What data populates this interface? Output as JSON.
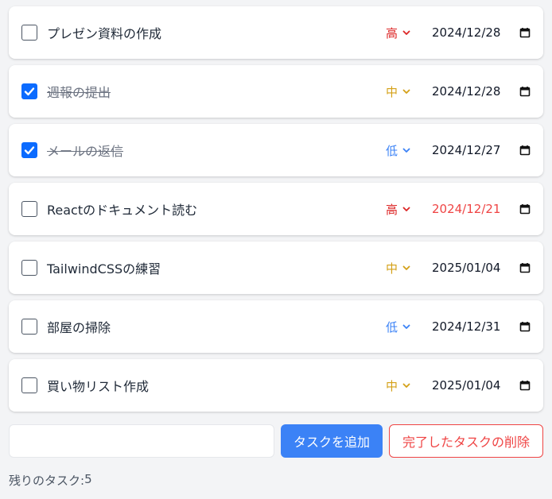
{
  "tasks": [
    {
      "title": "プレゼン資料の作成",
      "done": false,
      "priority": "高",
      "priority_level": "high",
      "due": "2024/12/28",
      "overdue": false
    },
    {
      "title": "週報の提出",
      "done": true,
      "priority": "中",
      "priority_level": "mid",
      "due": "2024/12/28",
      "overdue": false
    },
    {
      "title": "メールの返信",
      "done": true,
      "priority": "低",
      "priority_level": "low",
      "due": "2024/12/27",
      "overdue": false
    },
    {
      "title": "Reactのドキュメント読む",
      "done": false,
      "priority": "高",
      "priority_level": "high",
      "due": "2024/12/21",
      "overdue": true
    },
    {
      "title": "TailwindCSSの練習",
      "done": false,
      "priority": "中",
      "priority_level": "mid",
      "due": "2025/01/04",
      "overdue": false
    },
    {
      "title": "部屋の掃除",
      "done": false,
      "priority": "低",
      "priority_level": "low",
      "due": "2024/12/31",
      "overdue": false
    },
    {
      "title": "買い物リスト作成",
      "done": false,
      "priority": "中",
      "priority_level": "mid",
      "due": "2025/01/04",
      "overdue": false
    }
  ],
  "add_form": {
    "input_value": "",
    "input_placeholder": "",
    "add_label": "タスクを追加",
    "delete_completed_label": "完了したタスクの削除"
  },
  "footer": {
    "remaining_label": "残りのタスク:",
    "remaining_count": "5"
  },
  "colors": {
    "high": "#dc2626",
    "mid": "#d4a017",
    "low": "#3b82f6",
    "accent": "#3b82f6",
    "danger": "#ef4444",
    "checkbox_checked": "#0b6bff"
  },
  "icons": {
    "checkbox_check": "check-icon",
    "priority_toggle": "chevron-down-icon",
    "date_picker": "calendar-icon"
  }
}
